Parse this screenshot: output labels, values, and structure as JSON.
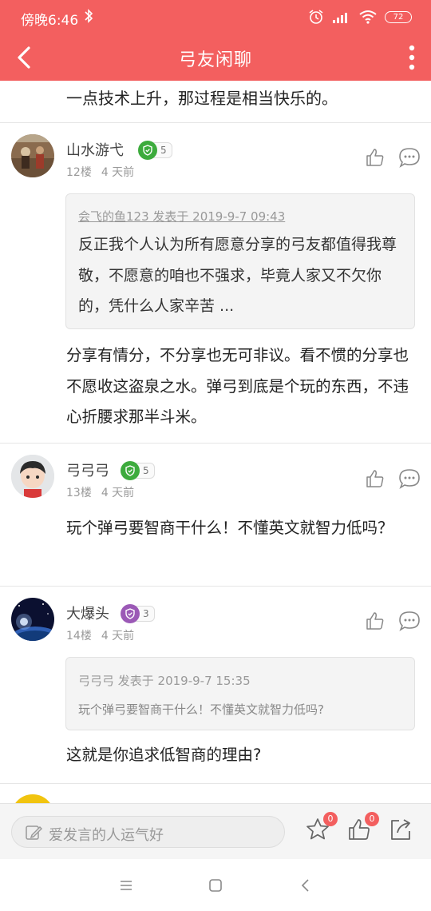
{
  "status_bar": {
    "time": "傍晚6:46",
    "battery": "72"
  },
  "app_bar": {
    "title": "弓友闲聊"
  },
  "top_fragment": "一点技术上升，那过程是相当快乐的。",
  "posts": [
    {
      "username": "山水游弋",
      "level": "5",
      "badge_color": "#3dab3d",
      "floor": "12楼",
      "time": "4 天前",
      "quote": {
        "header": "会飞的鱼123 发表于 2019-9-7 09:43",
        "text": "反正我个人认为所有愿意分享的弓友都值得我尊敬，不愿意的咱也不强求，毕竟人家又不欠你的，凭什么人家辛苦 ..."
      },
      "content": "分享有情分，不分享也无可非议。看不惯的分享也不愿收这盗泉之水。弹弓到底是个玩的东西，不违心折腰求那半斗米。"
    },
    {
      "username": "弓弓弓",
      "level": "5",
      "badge_color": "#3dab3d",
      "floor": "13楼",
      "time": "4 天前",
      "content": "玩个弹弓要智商干什么！不懂英文就智力低吗？"
    },
    {
      "username": "大爆头",
      "level": "3",
      "badge_color": "#9b59b6",
      "floor": "14楼",
      "time": "4 天前",
      "quote": {
        "header": "弓弓弓 发表于 2019-9-7 15:35",
        "text": "玩个弹弓要智商干什么！不懂英文就智力低吗?"
      },
      "content": "这就是你追求低智商的理由?"
    }
  ],
  "bottom_bar": {
    "placeholder": "爱发言的人运气好",
    "star_count": "0",
    "like_count": "0"
  },
  "colors": {
    "brand": "#f35f5f"
  }
}
